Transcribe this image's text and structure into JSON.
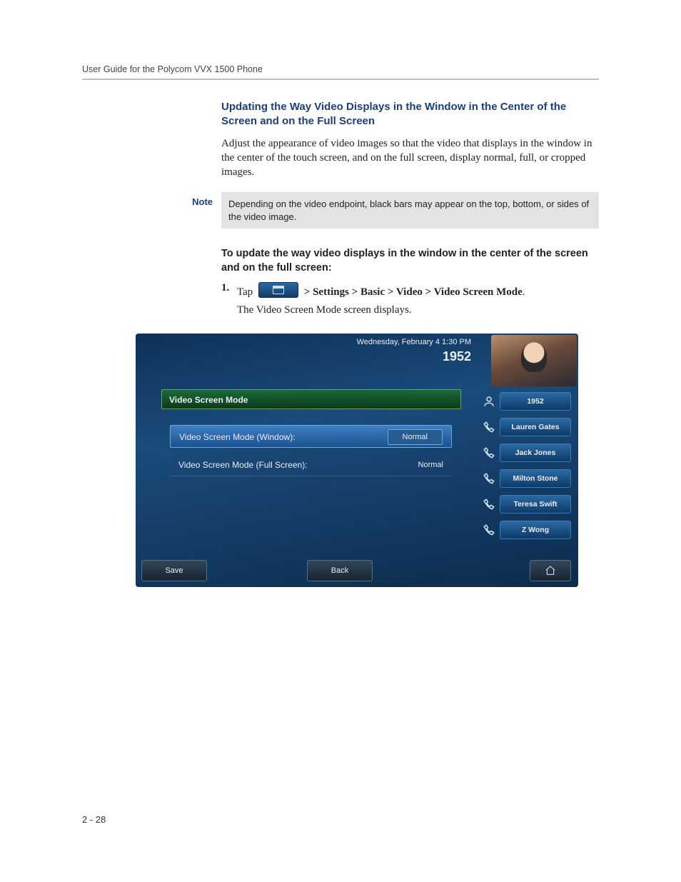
{
  "doc": {
    "running_header": "User Guide for the Polycom VVX 1500 Phone",
    "section_title": "Updating the Way Video Displays in the Window in the Center of the Screen and on the Full Screen",
    "intro_text": "Adjust the appearance of video images so that the video that displays in the window in the center of the touch screen, and on the full screen, display normal, full, or cropped images.",
    "note_label": "Note",
    "note_text": "Depending on the video endpoint, black bars may appear on the top, bottom, or sides of the video image.",
    "sub_heading": "To update the way video displays in the window in the center of the screen and on the full screen:",
    "step_num": "1.",
    "step_tap": "Tap",
    "step_path": "  > Settings > Basic > Video > Video Screen Mode",
    "step_period": ".",
    "step_follow": "The Video Screen Mode screen displays.",
    "page_number": "2 - 28"
  },
  "phone": {
    "date_time": "Wednesday, February 4  1:30 PM",
    "extension": "1952",
    "title_bar": "Video Screen Mode",
    "settings": [
      {
        "label": "Video Screen Mode (Window):",
        "value": "Normal",
        "selected": true
      },
      {
        "label": "Video Screen Mode (Full Screen):",
        "value": "Normal",
        "selected": false
      }
    ],
    "speed_dials": [
      {
        "label": "1952",
        "self": true
      },
      {
        "label": "Lauren Gates"
      },
      {
        "label": "Jack Jones"
      },
      {
        "label": "Milton Stone"
      },
      {
        "label": "Teresa Swift"
      },
      {
        "label": "Z Wong"
      }
    ],
    "softkeys": {
      "save": "Save",
      "back": "Back"
    }
  }
}
